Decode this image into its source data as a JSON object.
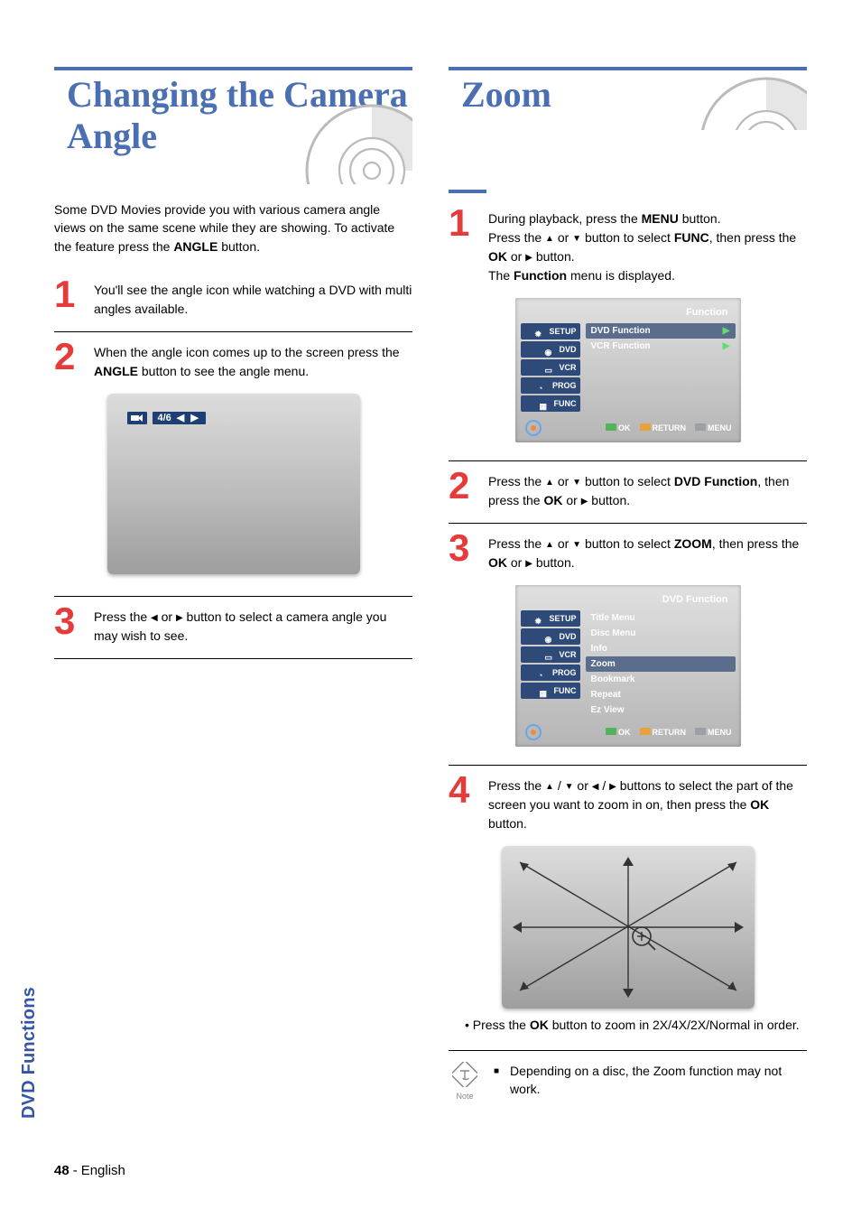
{
  "page": {
    "number": "48",
    "language": "English",
    "section_tab": "DVD Functions"
  },
  "left": {
    "title": "Changing the Camera Angle",
    "intro_html": "Some DVD Movies provide you with various camera angle views on the same scene while they are showing. To activate the feature press the <b>ANGLE</b> button.",
    "steps": [
      {
        "n": "1",
        "html": "You'll see the angle icon while watching a DVD with multi angles available."
      },
      {
        "n": "2",
        "html": "When the angle icon comes up to the screen press the <b>ANGLE</b> button to see the angle menu."
      },
      {
        "n": "3",
        "html": "Press the <span class='tri'>◀</span> or <span class='tri'>▶</span> button to select a camera angle you may wish to see."
      }
    ],
    "angle_osd": "4/6"
  },
  "right": {
    "title": "Zoom",
    "steps": [
      {
        "n": "1",
        "html": "During playback, press the <b>MENU</b> button.<br>Press the <span class='tri'>▲</span> or <span class='tri'>▼</span> button to select <b>FUNC</b>, then press the <b>OK</b> or <span class='tri'>▶</span> button.<br>The <b>Function</b> menu is displayed."
      },
      {
        "n": "2",
        "html": "Press the <span class='tri'>▲</span> or <span class='tri'>▼</span> button to select <b>DVD Function</b>, then press the <b>OK</b> or <span class='tri'>▶</span> button."
      },
      {
        "n": "3",
        "html": "Press the <span class='tri'>▲</span> or <span class='tri'>▼</span> button to select <b>ZOOM</b>, then press the <b>OK</b> or <span class='tri'>▶</span> button."
      },
      {
        "n": "4",
        "html": "Press the <span class='tri'>▲</span> / <span class='tri'>▼</span> or <span class='tri'>◀</span> / <span class='tri'>▶</span> buttons to select the part of the screen you want to zoom in on, then press the <b>OK</b> button."
      }
    ],
    "osd_func": {
      "title": "Function",
      "side": [
        "SETUP",
        "DVD",
        "VCR",
        "PROG",
        "FUNC"
      ],
      "rows": [
        {
          "label": "DVD Function",
          "arrow": true
        },
        {
          "label": "VCR Function",
          "arrow": true
        }
      ],
      "buttons": {
        "ok": "OK",
        "return": "RETURN",
        "menu": "MENU"
      }
    },
    "osd_dvd": {
      "title": "DVD Function",
      "side": [
        "SETUP",
        "DVD",
        "VCR",
        "PROG",
        "FUNC"
      ],
      "rows": [
        {
          "label": "Title Menu"
        },
        {
          "label": "Disc Menu"
        },
        {
          "label": "Info"
        },
        {
          "label": "Zoom",
          "hl": true
        },
        {
          "label": "Bookmark"
        },
        {
          "label": "Repeat"
        },
        {
          "label": "Ez View"
        }
      ],
      "buttons": {
        "ok": "OK",
        "return": "RETURN",
        "menu": "MENU"
      }
    },
    "zoom_note_html": "Press the <b>OK</b> button to zoom in 2X/4X/2X/Normal in order.",
    "note": {
      "label": "Note",
      "text": "Depending on a disc, the Zoom function may not work."
    }
  }
}
